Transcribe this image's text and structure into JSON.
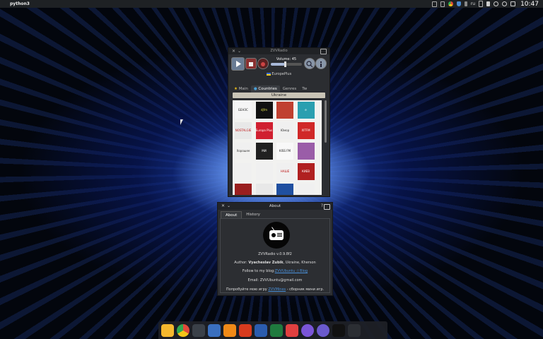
{
  "topbar": {
    "app_name": "python3",
    "keyboard_layout": "ru",
    "clock": "10:47"
  },
  "radio_window": {
    "title": "ZVVRadio",
    "volume_label": "Volume: 45",
    "volume_value": 45,
    "station": "EuropePlus",
    "tabs": [
      "Main",
      "Countries",
      "Genres",
      "Tw"
    ],
    "active_tab": "Countries",
    "country": "Ukraine",
    "stations": [
      {
        "name": "БЕНЗС",
        "color": "#f5f5f5",
        "text": "#222"
      },
      {
        "name": "djfm",
        "color": "#111111",
        "text": "#e8e84a"
      },
      {
        "name": "",
        "color": "#c04030",
        "text": "#fff"
      },
      {
        "name": "e",
        "color": "#2a9fb0",
        "text": "#fff"
      },
      {
        "name": "NOSTALGIE",
        "color": "#e8e8e8",
        "text": "#c02020"
      },
      {
        "name": "Europa Plus",
        "color": "#d02030",
        "text": "#fff"
      },
      {
        "name": "Юмор",
        "color": "#f0f0f0",
        "text": "#333"
      },
      {
        "name": "ХІТFM",
        "color": "#d02828",
        "text": "#fff"
      },
      {
        "name": "Хорошее",
        "color": "#f0f0f0",
        "text": "#333"
      },
      {
        "name": "МИ",
        "color": "#202020",
        "text": "#fff"
      },
      {
        "name": "KISS FM",
        "color": "#f8f8f8",
        "text": "#111"
      },
      {
        "name": "",
        "color": "#9a5da8",
        "text": "#fff"
      },
      {
        "name": "",
        "color": "#f0f0f0",
        "text": "#333"
      },
      {
        "name": "",
        "color": "#f0f0f0",
        "text": "#333"
      },
      {
        "name": "НАШЕ РАДИО",
        "color": "#f0f0f0",
        "text": "#c02020"
      },
      {
        "name": "КИЕВ",
        "color": "#b02020",
        "text": "#fff"
      },
      {
        "name": "",
        "color": "#9a1f1f",
        "text": "#fff"
      },
      {
        "name": "",
        "color": "#e8e8e8",
        "text": "#333"
      },
      {
        "name": "",
        "color": "#2050a0",
        "text": "#fff"
      },
      {
        "name": "",
        "color": "#f0f0f0",
        "text": "#333"
      }
    ]
  },
  "about_dialog": {
    "title": "About",
    "tabs": [
      "About",
      "History"
    ],
    "version": "ZVVRadio v.0.9.8f2",
    "author_prefix": "Author: ",
    "author_name": "Vyacheslav Zubik",
    "author_suffix": ", Ukraine, Kherson",
    "blog_prefix": "Follow to my blog:",
    "blog_link": "ZVVUbuntu :) Blog",
    "email_prefix": "Email: ",
    "email": "ZVVUbuntu@gmail.com",
    "games_prefix": "Попробуйте мою игру ",
    "games_link": "ZVVMines",
    "games_suffix": " - сборник мини игр."
  },
  "dock": {
    "apps": [
      {
        "name": "files",
        "color": "#f5b82e"
      },
      {
        "name": "chrome",
        "color": "#e04a3a"
      },
      {
        "name": "terminal",
        "color": "#3a4048"
      },
      {
        "name": "text-editor",
        "color": "#3a6fbf"
      },
      {
        "name": "vlc",
        "color": "#f08a18"
      },
      {
        "name": "office",
        "color": "#d83b1e"
      },
      {
        "name": "word",
        "color": "#2b5cae"
      },
      {
        "name": "excel",
        "color": "#1f7a3e"
      },
      {
        "name": "camera",
        "color": "#e04040"
      },
      {
        "name": "notes",
        "color": "#7a55d8"
      },
      {
        "name": "settings",
        "color": "#6a5acd"
      },
      {
        "name": "radio",
        "color": "#111111"
      },
      {
        "name": "trash",
        "color": "#2b2e33"
      }
    ]
  }
}
